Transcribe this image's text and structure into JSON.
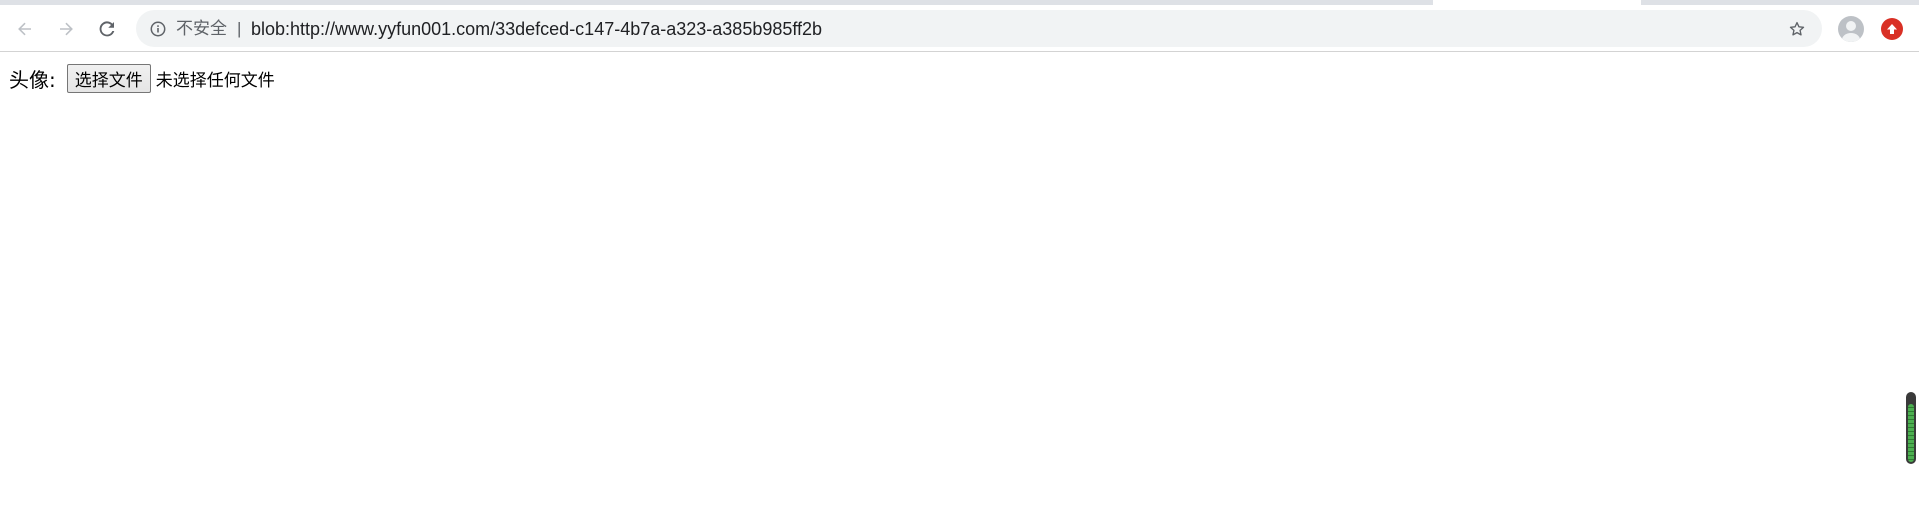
{
  "browser": {
    "security_label": "不安全",
    "separator": "|",
    "url": "blob:http://www.yyfun001.com/33defced-c147-4b7a-a323-a385b985ff2b",
    "icons": {
      "back": "arrow-left-icon",
      "forward": "arrow-right-icon",
      "reload": "reload-icon",
      "info": "info-icon",
      "bookmark": "star-icon",
      "profile": "avatar",
      "extension": "upload-arrow-icon"
    },
    "colors": {
      "extension_badge": "#d93025",
      "omnibox_bg": "#f1f3f4"
    }
  },
  "page": {
    "field_label": "头像:",
    "file_button_label": "选择文件",
    "file_status": "未选择任何文件"
  },
  "side_widget": {
    "fill_fraction": 0.85,
    "color": "#4caf50"
  }
}
